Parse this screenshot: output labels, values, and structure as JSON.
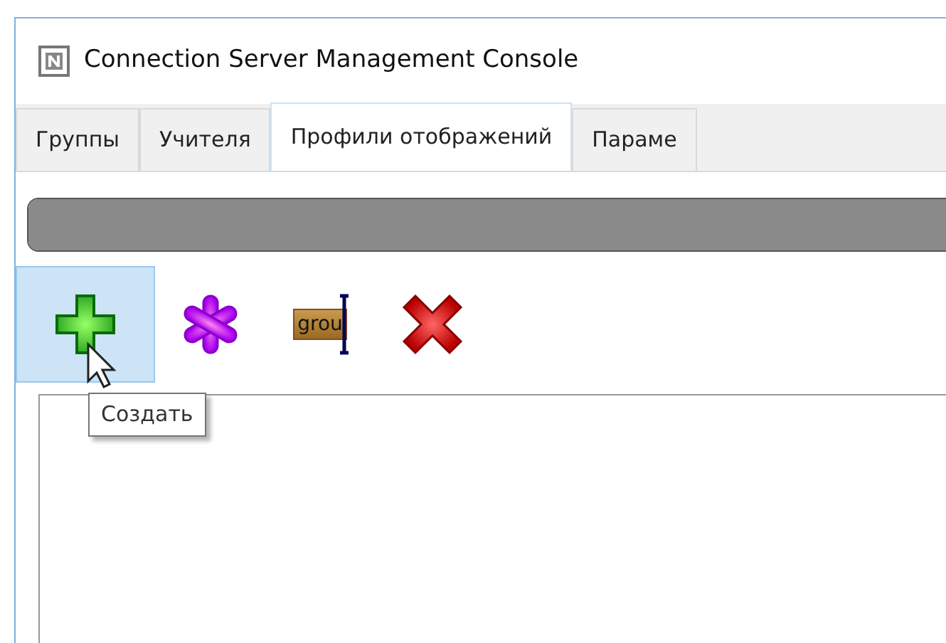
{
  "window": {
    "title": "Connection Server Management Console"
  },
  "tabs": [
    {
      "label": "Группы",
      "selected": false
    },
    {
      "label": "Учителя",
      "selected": false
    },
    {
      "label": "Профили отображений",
      "selected": true
    },
    {
      "label": "Параме",
      "selected": false
    }
  ],
  "progress": {
    "level": 1
  },
  "toolbar": [
    {
      "kind": "add",
      "hovered": true
    },
    {
      "kind": "asterisk",
      "hovered": false
    },
    {
      "kind": "rename",
      "text": "grou",
      "hovered": false
    },
    {
      "kind": "delete",
      "hovered": false
    }
  ],
  "tooltip": {
    "text": "Создать"
  }
}
